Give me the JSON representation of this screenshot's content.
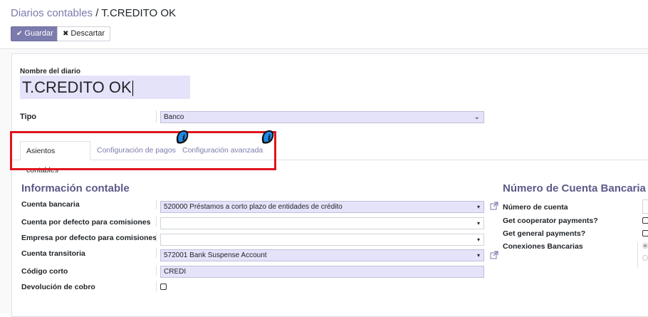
{
  "breadcrumb": {
    "parent": "Diarios contables",
    "separator": " / ",
    "current": "T.CREDITO OK"
  },
  "buttons": {
    "save": "Guardar",
    "discard": "Descartar"
  },
  "form": {
    "name_label": "Nombre del diario",
    "name_value": "T.CREDITO OK",
    "tipo_label": "Tipo",
    "tipo_value": "Banco"
  },
  "tabs": [
    {
      "label": "Asientos contables",
      "active": true
    },
    {
      "label": "Configuración de pagos",
      "active": false
    },
    {
      "label": "Configuración avanzada",
      "active": false
    }
  ],
  "info": {
    "title": "Información contable",
    "rows": [
      {
        "label": "Cuenta bancaria",
        "value": "520000 Préstamos a corto plazo de entidades de crédito"
      },
      {
        "label": "Cuenta por defecto para comisiones",
        "value": ""
      },
      {
        "label": "Empresa por defecto para comisiones",
        "value": ""
      },
      {
        "label": "Cuenta transitoria",
        "value": "572001 Bank Suspense Account"
      },
      {
        "label": "Código corto",
        "value": "CREDI"
      },
      {
        "label": "Devolución de cobro",
        "value": ""
      }
    ]
  },
  "bank": {
    "title": "Número de Cuenta Bancaria",
    "rows": [
      {
        "label": "Número de cuenta"
      },
      {
        "label": "Get cooperator payments?"
      },
      {
        "label": "Get general payments?"
      },
      {
        "label": "Conexiones Bancarias"
      }
    ]
  },
  "colors": {
    "accent": "#7c7bad",
    "highlight_border": "#e0141e",
    "badge": "#1e88e5",
    "field_bg": "#e4e3fa"
  }
}
